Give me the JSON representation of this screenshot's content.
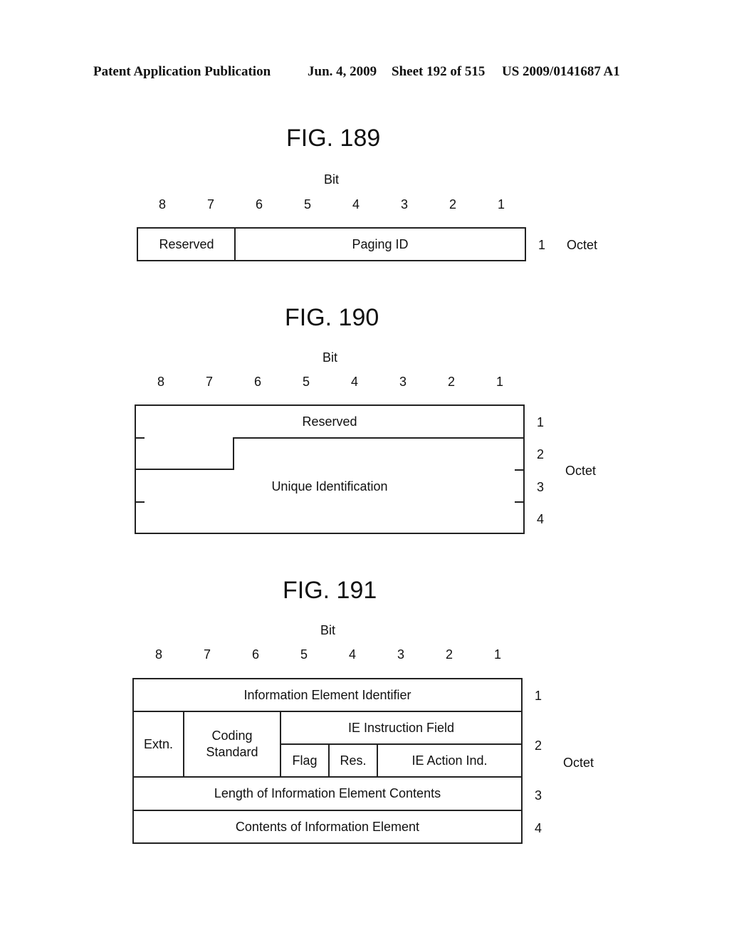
{
  "header": {
    "left": "Patent Application Publication",
    "date": "Jun. 4, 2009",
    "sheet": "Sheet 192 of 515",
    "number": "US 2009/0141687 A1"
  },
  "bits": [
    "8",
    "7",
    "6",
    "5",
    "4",
    "3",
    "2",
    "1"
  ],
  "bit_label": "Bit",
  "octet_label": "Octet",
  "fig189": {
    "title": "FIG. 189",
    "fields": [
      "Reserved",
      "Paging ID"
    ],
    "octets": [
      "1"
    ]
  },
  "fig190": {
    "title": "FIG. 190",
    "fields": [
      "Reserved",
      "Unique Identification"
    ],
    "octets": [
      "1",
      "2",
      "3",
      "4"
    ]
  },
  "fig191": {
    "title": "FIG. 191",
    "fields": {
      "ie_identifier": "Information Element Identifier",
      "extn": "Extn.",
      "coding_standard": "Coding Standard",
      "ie_instruction": "IE Instruction Field",
      "flag": "Flag",
      "res": "Res.",
      "ie_action": "IE Action Ind.",
      "length": "Length of Information Element Contents",
      "contents": "Contents of Information Element"
    },
    "octets": [
      "1",
      "2",
      "3",
      "4"
    ]
  }
}
